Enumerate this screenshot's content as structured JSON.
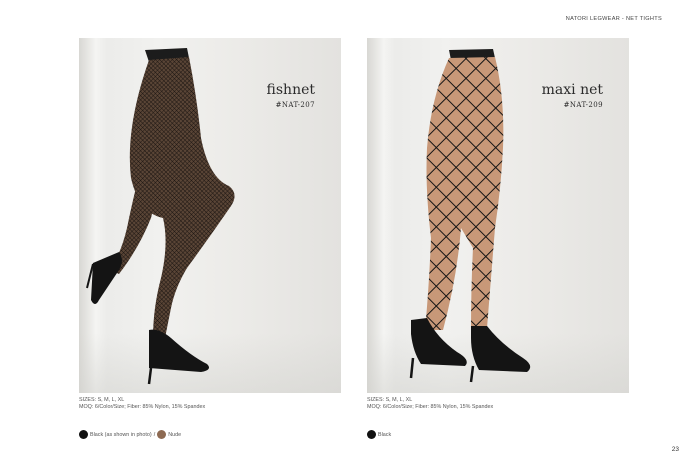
{
  "header": {
    "title": "NATORI LEGWEAR - NET TIGHTS"
  },
  "products": [
    {
      "name": "fishnet",
      "code": "#NAT-207",
      "sizes": "SIZES: S, M, L, XL",
      "moq": "MOQ: 6/Color/Size; Fiber: 85% Nylon, 15% Spandex",
      "colors": [
        {
          "label": "Black (as shown in photo)",
          "hex": "#111111"
        },
        {
          "label": "Nude",
          "hex": "#8d6a52"
        }
      ],
      "color_separator": "/"
    },
    {
      "name": "maxi net",
      "code": "#NAT-209",
      "sizes": "SIZES: S, M, L, XL",
      "moq": "MOQ: 6/Color/Size; Fiber: 85% Nylon, 15% Spandex",
      "colors": [
        {
          "label": "Black",
          "hex": "#111111"
        }
      ]
    }
  ],
  "page_number": "23"
}
